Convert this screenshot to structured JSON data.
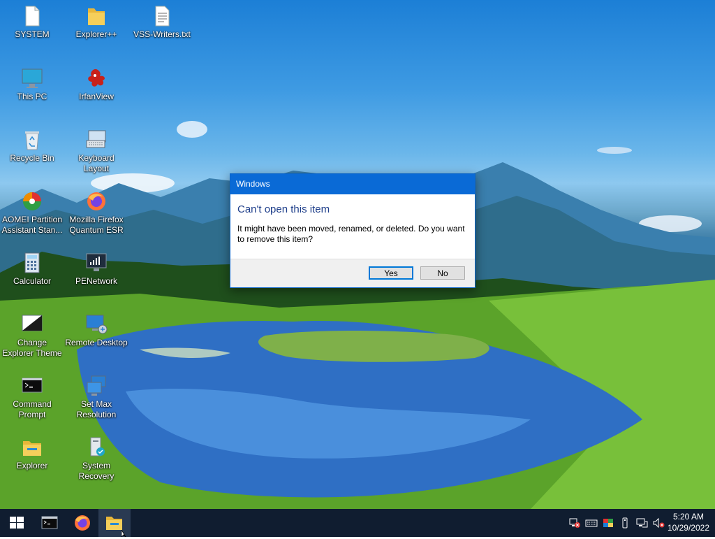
{
  "desktop": {
    "icons": [
      {
        "label": "SYSTEM",
        "icon": "document-icon"
      },
      {
        "label": "Explorer++",
        "icon": "folder-icon"
      },
      {
        "label": "VSS-Writers.txt",
        "icon": "text-file-icon"
      },
      {
        "label": "This PC",
        "icon": "monitor-icon"
      },
      {
        "label": "IrfanView",
        "icon": "irfanview-icon"
      },
      {
        "label": "Recycle Bin",
        "icon": "recycle-bin-icon"
      },
      {
        "label": "Keyboard Layout",
        "icon": "keyboard-layout-icon"
      },
      {
        "label": "AOMEI Partition Assistant Stan...",
        "icon": "aomei-icon"
      },
      {
        "label": "Mozilla Firefox Quantum ESR",
        "icon": "firefox-icon"
      },
      {
        "label": "Calculator",
        "icon": "calculator-icon"
      },
      {
        "label": "PENetwork",
        "icon": "network-icon"
      },
      {
        "label": "Change Explorer Theme",
        "icon": "theme-icon"
      },
      {
        "label": "Remote Desktop",
        "icon": "remote-desktop-icon"
      },
      {
        "label": "Command Prompt",
        "icon": "command-prompt-icon"
      },
      {
        "label": "Set Max Resolution",
        "icon": "resolution-icon"
      },
      {
        "label": "Explorer",
        "icon": "explorer-folder-icon"
      },
      {
        "label": "System Recovery",
        "icon": "system-recovery-icon"
      }
    ]
  },
  "dialog": {
    "title": "Windows",
    "heading": "Can't open this item",
    "message": "It might have been moved, renamed, or deleted. Do you want to remove this item?",
    "yes_label": "Yes",
    "no_label": "No"
  },
  "taskbar": {
    "start": "windows-start-icon",
    "pinned": [
      "command-prompt-icon",
      "firefox-icon",
      "file-explorer-icon"
    ],
    "tray_icons": [
      "network-disconnected-icon",
      "keyboard-icon",
      "color-icon",
      "usb-icon",
      "network-icon",
      "volume-muted-icon"
    ],
    "clock_time": "5:20 AM",
    "clock_date": "10/29/2022"
  },
  "colors": {
    "titlebar": "#0a6ad6",
    "heading": "#1e3e8a",
    "taskbar": "#101d30"
  }
}
